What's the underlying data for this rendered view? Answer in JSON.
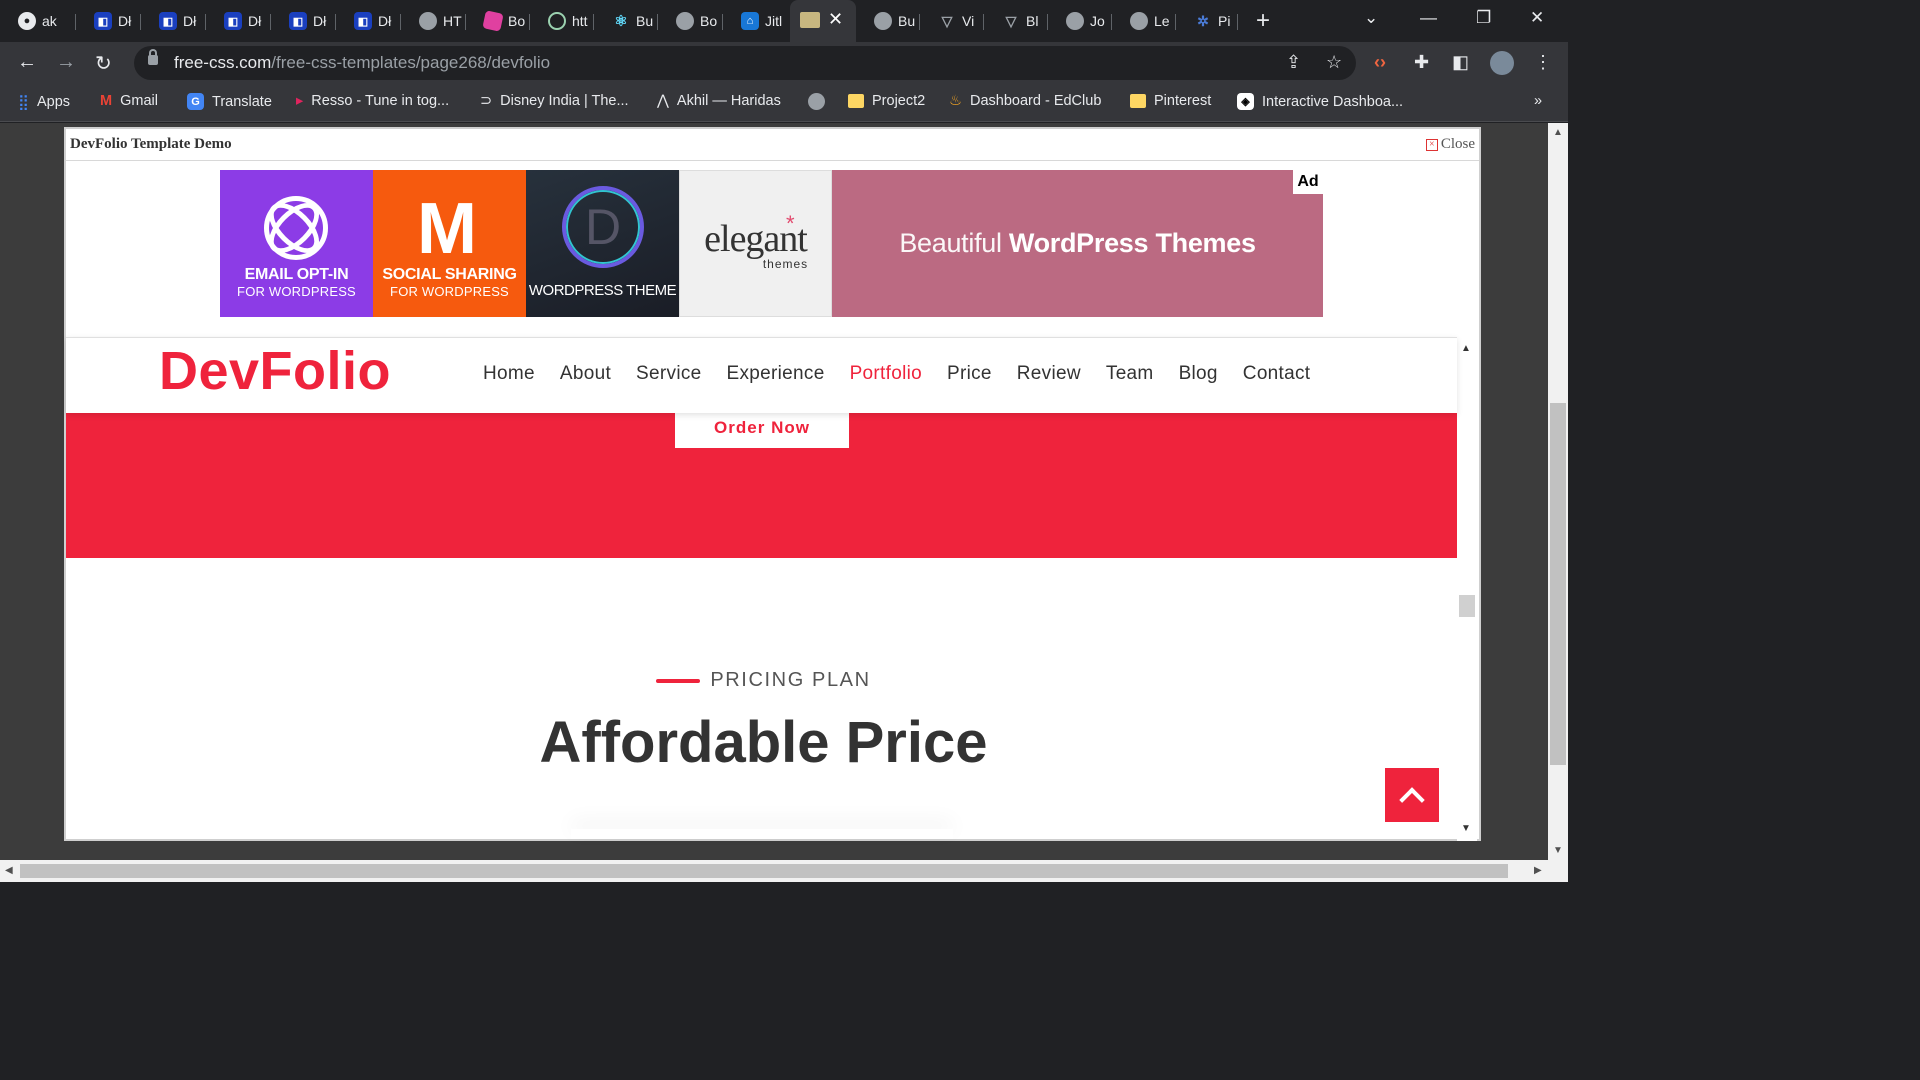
{
  "browser": {
    "tabs": [
      {
        "label": "ak",
        "icon": "github-icon"
      },
      {
        "label": "Dł",
        "icon": "dhiwise-icon"
      },
      {
        "label": "Dł",
        "icon": "dhiwise-icon"
      },
      {
        "label": "Dł",
        "icon": "dhiwise-icon"
      },
      {
        "label": "Dł",
        "icon": "dhiwise-icon"
      },
      {
        "label": "Dł",
        "icon": "dhiwise-icon"
      },
      {
        "label": "HT",
        "icon": "globe-icon"
      },
      {
        "label": "Bo",
        "icon": "cube-icon"
      },
      {
        "label": "htt",
        "icon": "chatgpt-icon"
      },
      {
        "label": "Bu",
        "icon": "react-icon"
      },
      {
        "label": "Bo",
        "icon": "globe-icon"
      },
      {
        "label": "Jitl",
        "icon": "jitl-icon"
      },
      {
        "label": "Bu",
        "icon": "globe-icon"
      },
      {
        "label": "Vi",
        "icon": "v-icon"
      },
      {
        "label": "Bl",
        "icon": "v-icon"
      },
      {
        "label": "Jo",
        "icon": "globe-icon"
      },
      {
        "label": "Le",
        "icon": "globe-icon"
      },
      {
        "label": "Pi",
        "icon": "pix-icon"
      }
    ],
    "url_host": "free-css.com",
    "url_path": "/free-css-templates/page268/devfolio",
    "bookmarks": [
      {
        "label": "Apps",
        "icon": "apps-grid-icon"
      },
      {
        "label": "Gmail",
        "icon": "gmail-icon"
      },
      {
        "label": "Translate",
        "icon": "translate-icon"
      },
      {
        "label": "Resso - Tune in tog...",
        "icon": "resso-icon"
      },
      {
        "label": "Disney India | The...",
        "icon": "disney-icon"
      },
      {
        "label": "Akhil — Haridas",
        "icon": "akhil-icon"
      },
      {
        "label": "",
        "icon": "globe-icon"
      },
      {
        "label": "Project2",
        "icon": "folder-icon"
      },
      {
        "label": "Dashboard - EdClub",
        "icon": "edclub-icon"
      },
      {
        "label": "Pinterest",
        "icon": "folder-icon"
      },
      {
        "label": "Interactive Dashboa...",
        "icon": "codepen-icon"
      }
    ],
    "more": "»"
  },
  "demo": {
    "title": "DevFolio Template Demo",
    "close_label": "Close"
  },
  "ad": {
    "badge": "Ad",
    "tile1_line1": "EMAIL OPT-IN",
    "tile1_line2": "FOR WORDPRESS",
    "tile2_line1": "SOCIAL SHARING",
    "tile2_line2": "FOR WORDPRESS",
    "tile3_letter": "D",
    "tile3_line1": "WORDPRESS THEME",
    "tile4_word1": "elegant",
    "tile4_word2": "themes",
    "tile5_light": "Beautiful ",
    "tile5_bold": "WordPress Themes"
  },
  "site": {
    "logo": "DevFolio",
    "nav": [
      "Home",
      "About",
      "Service",
      "Experience",
      "Portfolio",
      "Price",
      "Review",
      "Team",
      "Blog",
      "Contact"
    ],
    "active_nav": "Portfolio",
    "order_button": "Order Now",
    "section_label": "PRICING PLAN",
    "section_heading": "Affordable Price"
  },
  "colors": {
    "brand_red": "#ef233c",
    "ad_purple": "#8c3ce6",
    "ad_orange": "#f65a0e",
    "ad_pink": "#bb6a82"
  }
}
